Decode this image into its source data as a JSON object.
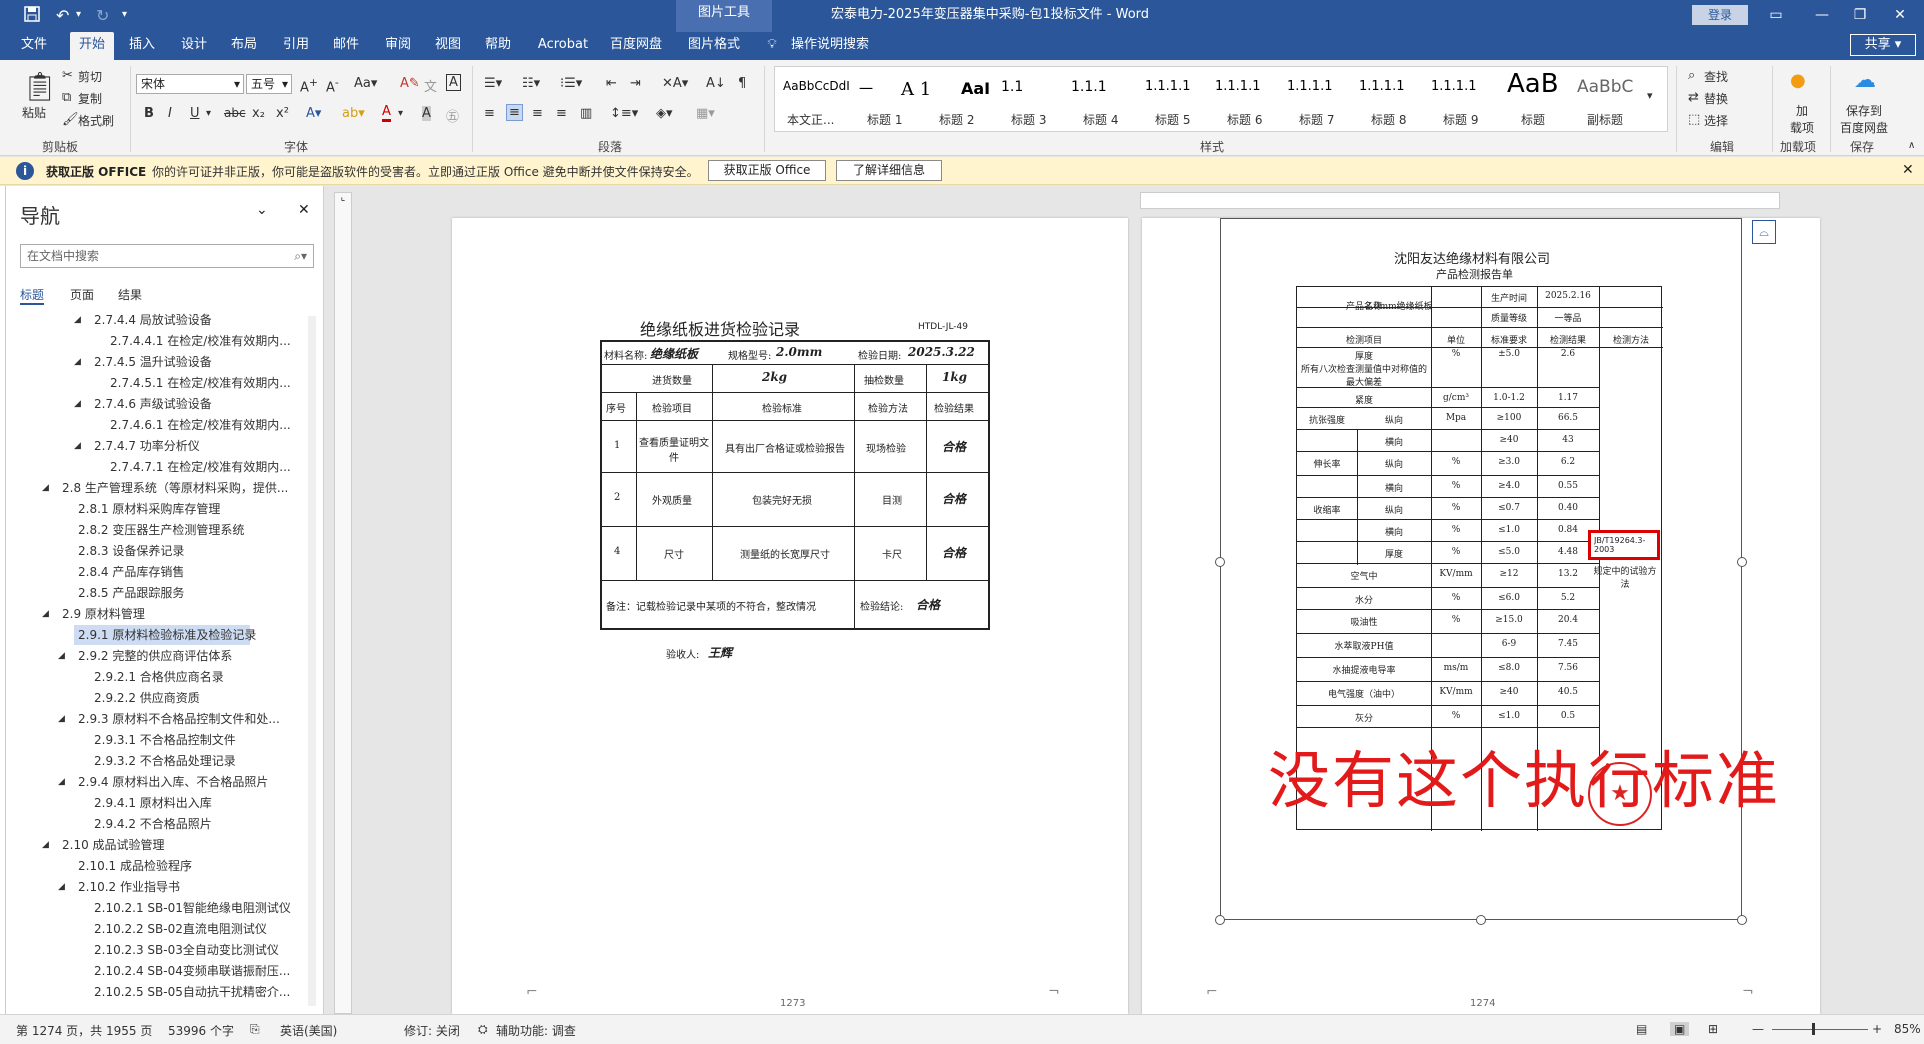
{
  "titlebar": {
    "picture_tools": "图片工具",
    "document_title": "宏泰电力-2025年变压器集中采购-包1投标文件 - Word",
    "login": "登录",
    "save_icon": "save-icon",
    "undo_icon": "undo-icon"
  },
  "tabs": [
    "文件",
    "开始",
    "插入",
    "设计",
    "布局",
    "引用",
    "邮件",
    "审阅",
    "视图",
    "帮助",
    "Acrobat",
    "百度网盘",
    "图片格式"
  ],
  "tell_me": "操作说明搜索",
  "share": "共享",
  "ribbon": {
    "paste": "粘贴",
    "cut": "剪切",
    "copy": "复制",
    "format_painter": "格式刷",
    "clipboard": "剪贴板",
    "font_name": "宋体",
    "font_size": "五号",
    "font": "字体",
    "paragraph": "段落",
    "styles": "样式",
    "style_previews": [
      "AaBbCcDdI",
      "一",
      "A 1",
      "AaI",
      "1.1",
      "1.1.1",
      "1.1.1.1",
      "1.1.1.1",
      "1.1.1.1",
      "1.1.1.1",
      "1.1.1.1",
      "AaB",
      "AaBbC"
    ],
    "style_names": [
      "本文正...",
      "标题 1",
      "标题 2",
      "标题 3",
      "标题 4",
      "标题 5",
      "标题 6",
      "标题 7",
      "标题 8",
      "标题 9",
      "标题",
      "副标题"
    ],
    "find": "查找",
    "replace": "替换",
    "select": "选择",
    "editing": "编辑",
    "addins": "加载项",
    "addins_btn": "加\n载项",
    "save_baidu": "保存到\n百度网盘",
    "save": "保存"
  },
  "infobar": {
    "title": "获取正版 OFFICE",
    "text": "你的许可证并非正版，你可能是盗版软件的受害者。立即通过正版 Office 避免中断并使文件保持安全。",
    "btn1": "获取正版 Office",
    "btn2": "了解详细信息"
  },
  "nav": {
    "title": "导航",
    "search_placeholder": "在文档中搜索",
    "tabs": [
      "标题",
      "页面",
      "结果"
    ],
    "items": [
      {
        "text": "2.7.4.4 局放试验设备",
        "indent": 2,
        "arrow": true
      },
      {
        "text": "2.7.4.4.1 在检定/校准有效期内...",
        "indent": 3,
        "arrow": false
      },
      {
        "text": "2.7.4.5 温升试验设备",
        "indent": 2,
        "arrow": true
      },
      {
        "text": "2.7.4.5.1 在检定/校准有效期内...",
        "indent": 3,
        "arrow": false
      },
      {
        "text": "2.7.4.6 声级试验设备",
        "indent": 2,
        "arrow": true
      },
      {
        "text": "2.7.4.6.1 在检定/校准有效期内...",
        "indent": 3,
        "arrow": false
      },
      {
        "text": "2.7.4.7 功率分析仪",
        "indent": 2,
        "arrow": true
      },
      {
        "text": "2.7.4.7.1 在检定/校准有效期内...",
        "indent": 3,
        "arrow": false
      },
      {
        "text": "2.8 生产管理系统（等原材料采购，提供...",
        "indent": 0,
        "arrow": true
      },
      {
        "text": "2.8.1 原材料采购库存管理",
        "indent": 1,
        "arrow": false
      },
      {
        "text": "2.8.2 变压器生产检测管理系统",
        "indent": 1,
        "arrow": false
      },
      {
        "text": "2.8.3 设备保养记录",
        "indent": 1,
        "arrow": false
      },
      {
        "text": "2.8.4 产品库存销售",
        "indent": 1,
        "arrow": false
      },
      {
        "text": "2.8.5 产品跟踪服务",
        "indent": 1,
        "arrow": false
      },
      {
        "text": "2.9 原材料管理",
        "indent": 0,
        "arrow": true
      },
      {
        "text": "2.9.1 原材料检验标准及检验记录",
        "indent": 1,
        "arrow": false,
        "selected": true
      },
      {
        "text": "2.9.2 完整的供应商评估体系",
        "indent": 1,
        "arrow": true
      },
      {
        "text": "2.9.2.1 合格供应商名录",
        "indent": 2,
        "arrow": false
      },
      {
        "text": "2.9.2.2 供应商资质",
        "indent": 2,
        "arrow": false
      },
      {
        "text": "2.9.3 原材料不合格品控制文件和处...",
        "indent": 1,
        "arrow": true
      },
      {
        "text": "2.9.3.1 不合格品控制文件",
        "indent": 2,
        "arrow": false
      },
      {
        "text": "2.9.3.2 不合格品处理记录",
        "indent": 2,
        "arrow": false
      },
      {
        "text": "2.9.4 原材料出入库、不合格品照片",
        "indent": 1,
        "arrow": true
      },
      {
        "text": "2.9.4.1 原材料出入库",
        "indent": 2,
        "arrow": false
      },
      {
        "text": "2.9.4.2 不合格品照片",
        "indent": 2,
        "arrow": false
      },
      {
        "text": "2.10 成品试验管理",
        "indent": 0,
        "arrow": true
      },
      {
        "text": "2.10.1 成品检验程序",
        "indent": 1,
        "arrow": false
      },
      {
        "text": "2.10.2 作业指导书",
        "indent": 1,
        "arrow": true
      },
      {
        "text": "2.10.2.1 SB-01智能绝缘电阻测试仪",
        "indent": 2,
        "arrow": false
      },
      {
        "text": "2.10.2.2 SB-02直流电阻测试仪",
        "indent": 2,
        "arrow": false
      },
      {
        "text": "2.10.2.3 SB-03全自动变比测试仪",
        "indent": 2,
        "arrow": false
      },
      {
        "text": "2.10.2.4 SB-04变频串联谐振耐压...",
        "indent": 2,
        "arrow": false
      },
      {
        "text": "2.10.2.5 SB-05自动抗干扰精密介...",
        "indent": 2,
        "arrow": false
      }
    ]
  },
  "page1": {
    "title": "绝缘纸板进货检验记录",
    "code": "HTDL-JL-49",
    "material_label": "材料名称:",
    "material_value": "绝缘纸板",
    "spec_label": "规格型号:",
    "spec_value": "2.0mm",
    "date_label": "检验日期:",
    "date_value": "2025.3.22",
    "qty_label": "进货数量",
    "qty_value": "2kg",
    "sample_label": "抽检数量",
    "sample_value": "1kg",
    "headers": [
      "序号",
      "检验项目",
      "检验标准",
      "检验方法",
      "检验结果"
    ],
    "rows": [
      {
        "no": "1",
        "item": "查看质量证明文件",
        "std": "具有出厂合格证或检验报告",
        "method": "现场检验",
        "result": "合格"
      },
      {
        "no": "2",
        "item": "外观质量",
        "std": "包装完好无损",
        "method": "目测",
        "result": "合格"
      },
      {
        "no": "4",
        "item": "尺寸",
        "std": "测量纸的长宽厚尺寸",
        "method": "卡尺",
        "result": "合格"
      }
    ],
    "remark": "备注：记载检验记录中某项的不符合，整改情况",
    "conclusion_label": "检验结论:",
    "conclusion_value": "合格",
    "receiver_label": "验收人:",
    "receiver_value": "王辉",
    "page_number": "1273"
  },
  "page2": {
    "company": "沈阳友达绝缘材料有限公司",
    "report": "产品检测报告单",
    "product_label": "产品名称",
    "product_value": "2.0mm绝缘纸板",
    "prod_time_label": "生产时间",
    "prod_time_value": "2025.2.16",
    "grade_label": "质量等级",
    "grade_value": "一等品",
    "headers": [
      "检测项目",
      "单位",
      "标准要求",
      "检测结果",
      "检测方法"
    ],
    "rows": [
      {
        "item": "厚度\n所有八次检查测量值中对称值的最大偏差",
        "sub": "",
        "unit": "%",
        "std": "±5.0",
        "res": "2.6"
      },
      {
        "item": "紧度",
        "sub": "",
        "unit": "g/cm³",
        "std": "1.0-1.2",
        "res": "1.17"
      },
      {
        "item": "抗张强度",
        "sub": "纵向",
        "unit": "Mpa",
        "std": "≥100",
        "res": "66.5"
      },
      {
        "item": "",
        "sub": "横向",
        "unit": "",
        "std": "≥40",
        "res": "43"
      },
      {
        "item": "伸长率",
        "sub": "纵向",
        "unit": "%",
        "std": "≥3.0",
        "res": "6.2"
      },
      {
        "item": "",
        "sub": "横向",
        "unit": "%",
        "std": "≥4.0",
        "res": "0.55"
      },
      {
        "item": "收缩率",
        "sub": "纵向",
        "unit": "%",
        "std": "≤0.7",
        "res": "0.40"
      },
      {
        "item": "",
        "sub": "横向",
        "unit": "%",
        "std": "≤1.0",
        "res": "0.84"
      },
      {
        "item": "",
        "sub": "厚度",
        "unit": "%",
        "std": "≤5.0",
        "res": "4.48"
      },
      {
        "item": "空气中",
        "sub": "",
        "unit": "KV/mm",
        "std": "≥12",
        "res": "13.2"
      },
      {
        "item": "水分",
        "sub": "",
        "unit": "%",
        "std": "≤6.0",
        "res": "5.2"
      },
      {
        "item": "吸油性",
        "sub": "",
        "unit": "%",
        "std": "≥15.0",
        "res": "20.4"
      },
      {
        "item": "水萃取液PH值",
        "sub": "",
        "unit": "",
        "std": "6-9",
        "res": "7.45"
      },
      {
        "item": "水抽提液电导率",
        "sub": "",
        "unit": "ms/m",
        "std": "≤8.0",
        "res": "7.56"
      },
      {
        "item": "电气强度（油中）",
        "sub": "",
        "unit": "KV/mm",
        "std": "≥40",
        "res": "40.5"
      },
      {
        "item": "灰分",
        "sub": "",
        "unit": "%",
        "std": "≤1.0",
        "res": "0.5"
      }
    ],
    "method_std": "JB/T19264.3-2003",
    "method_text": "规定中的试验方法",
    "annotation": "没有这个执行标准",
    "page_number": "1274"
  },
  "status": {
    "page": "第 1274 页，共 1955 页",
    "words": "53996 个字",
    "lang": "英语(美国)",
    "track": "修订: 关闭",
    "access": "辅助功能: 调查",
    "zoom": "85%"
  }
}
